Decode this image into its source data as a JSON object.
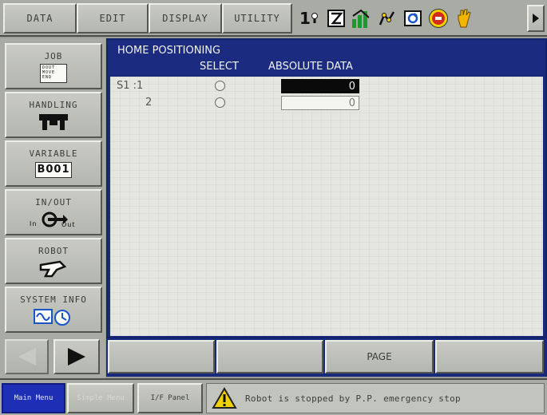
{
  "top_menu": {
    "tabs": [
      {
        "label": "DATA"
      },
      {
        "label": "EDIT"
      },
      {
        "label": "DISPLAY"
      },
      {
        "label": "UTILITY"
      }
    ],
    "status_icons": [
      "one-tool-icon",
      "edit-lock-icon",
      "play-mode-icon",
      "robot-job-icon",
      "cycle-mode-icon",
      "emergency-stop-icon",
      "hand-servo-icon"
    ],
    "tool_number": "1"
  },
  "sidebar": {
    "items": [
      {
        "label": "JOB",
        "icon": "job-file-icon",
        "icon_text": [
          "DOUT",
          "MOVE",
          "END"
        ]
      },
      {
        "label": "HANDLING",
        "icon": "gripper-icon"
      },
      {
        "label": "VARIABLE",
        "icon": "variable-icon",
        "icon_text": "B001"
      },
      {
        "label": "IN/OUT",
        "icon": "in-out-icon",
        "in_label": "In",
        "out_label": "Out"
      },
      {
        "label": "ROBOT",
        "icon": "robot-arm-icon"
      },
      {
        "label": "SYSTEM INFO",
        "icon": "system-info-icon"
      }
    ]
  },
  "main": {
    "title": "HOME POSITIONING",
    "col_select": "SELECT",
    "col_absolute": "ABSOLUTE DATA",
    "rows": [
      {
        "axis": "S1 :1",
        "value": "0",
        "selected": false
      },
      {
        "axis": "2",
        "value": "0",
        "selected": false
      }
    ]
  },
  "function_keys": [
    {
      "label": ""
    },
    {
      "label": ""
    },
    {
      "label": "PAGE"
    },
    {
      "label": ""
    }
  ],
  "status_bar": {
    "main_menu": "Main Menu",
    "simple_menu": "Simple Menu",
    "if_panel": "I/F Panel",
    "message": "Robot is stopped by P.P. emergency stop"
  },
  "colors": {
    "window_blue": "#1a2a7a",
    "main_menu_blue": "#1f2fb5",
    "panel_gray": "#a9aba5",
    "estop_red": "#d42a1c",
    "warning_yellow": "#f2d100"
  }
}
